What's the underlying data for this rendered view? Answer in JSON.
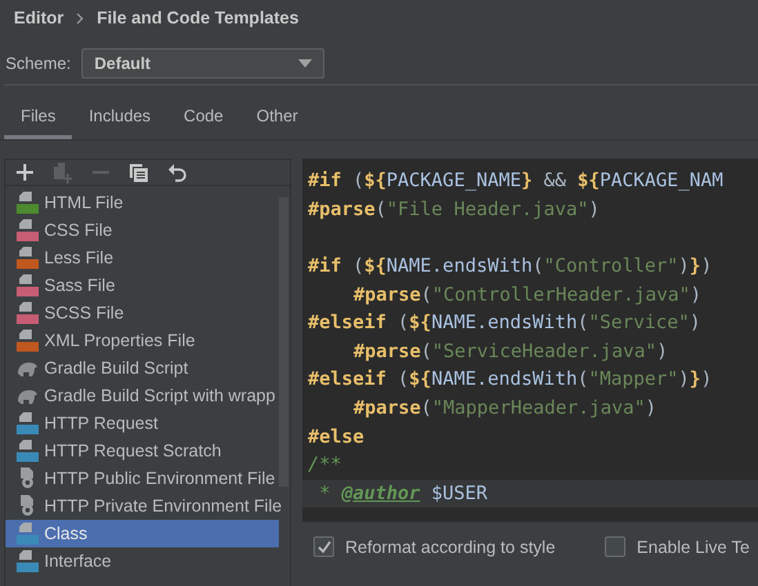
{
  "breadcrumb": [
    "Editor",
    "File and Code Templates"
  ],
  "scheme": {
    "label": "Scheme:",
    "value": "Default"
  },
  "tabs": [
    {
      "label": "Files",
      "selected": true
    },
    {
      "label": "Includes",
      "selected": false
    },
    {
      "label": "Code",
      "selected": false
    },
    {
      "label": "Other",
      "selected": false
    }
  ],
  "toolbar": [
    {
      "kind": "add",
      "disabled": false
    },
    {
      "kind": "add-file",
      "disabled": true
    },
    {
      "kind": "remove",
      "disabled": true
    },
    {
      "kind": "copy",
      "disabled": false
    },
    {
      "kind": "revert",
      "disabled": false
    }
  ],
  "templates": [
    {
      "label": "HTML File",
      "kind": "html",
      "selected": false
    },
    {
      "label": "CSS File",
      "kind": "css",
      "selected": false
    },
    {
      "label": "Less File",
      "kind": "less",
      "selected": false
    },
    {
      "label": "Sass File",
      "kind": "sass",
      "selected": false
    },
    {
      "label": "SCSS File",
      "kind": "sass",
      "selected": false
    },
    {
      "label": "XML Properties File",
      "kind": "xml",
      "selected": false
    },
    {
      "label": "Gradle Build Script",
      "kind": "gradle",
      "selected": false
    },
    {
      "label": "Gradle Build Script with wrapp",
      "kind": "gradle",
      "selected": false
    },
    {
      "label": "HTTP Request",
      "kind": "api",
      "selected": false
    },
    {
      "label": "HTTP Request Scratch",
      "kind": "api",
      "selected": false
    },
    {
      "label": "HTTP Public Environment File",
      "kind": "env",
      "selected": false
    },
    {
      "label": "HTTP Private Environment File",
      "kind": "env",
      "selected": false
    },
    {
      "label": "Class",
      "kind": "java",
      "selected": true
    },
    {
      "label": "Interface",
      "kind": "java",
      "selected": false
    }
  ],
  "code": [
    {
      "kind": "code",
      "indented": false,
      "current": false,
      "segments": [
        {
          "kind": "dir",
          "text": "#if"
        },
        {
          "kind": "punct",
          "text": " ("
        },
        {
          "kind": "brace",
          "text": "${"
        },
        {
          "kind": "var",
          "text": "PACKAGE_NAME"
        },
        {
          "kind": "brace",
          "text": "}"
        },
        {
          "kind": "punct",
          "text": " && "
        },
        {
          "kind": "brace",
          "text": "${"
        },
        {
          "kind": "var",
          "text": "PACKAGE_NAM"
        }
      ]
    },
    {
      "kind": "code",
      "indented": false,
      "current": false,
      "segments": [
        {
          "kind": "dir",
          "text": "#parse"
        },
        {
          "kind": "punct",
          "text": "("
        },
        {
          "kind": "str",
          "text": "\"File Header.java\""
        },
        {
          "kind": "punct",
          "text": ")"
        }
      ]
    },
    {
      "kind": "blank"
    },
    {
      "kind": "code",
      "indented": false,
      "current": false,
      "segments": [
        {
          "kind": "dir",
          "text": "#if"
        },
        {
          "kind": "punct",
          "text": " ("
        },
        {
          "kind": "brace",
          "text": "${"
        },
        {
          "kind": "var",
          "text": "NAME.endsWith"
        },
        {
          "kind": "punct",
          "text": "("
        },
        {
          "kind": "str",
          "text": "\"Controller\""
        },
        {
          "kind": "punct",
          "text": ")"
        },
        {
          "kind": "brace",
          "text": "}"
        },
        {
          "kind": "punct",
          "text": ")"
        }
      ]
    },
    {
      "kind": "code",
      "indented": true,
      "current": false,
      "segments": [
        {
          "kind": "dir",
          "text": "#parse"
        },
        {
          "kind": "punct",
          "text": "("
        },
        {
          "kind": "str",
          "text": "\"ControllerHeader.java\""
        },
        {
          "kind": "punct",
          "text": ")"
        }
      ]
    },
    {
      "kind": "code",
      "indented": false,
      "current": false,
      "segments": [
        {
          "kind": "dir",
          "text": "#elseif"
        },
        {
          "kind": "punct",
          "text": " ("
        },
        {
          "kind": "brace",
          "text": "${"
        },
        {
          "kind": "var",
          "text": "NAME.endsWith"
        },
        {
          "kind": "punct",
          "text": "("
        },
        {
          "kind": "str",
          "text": "\"Service\""
        },
        {
          "kind": "punct",
          "text": ")"
        }
      ]
    },
    {
      "kind": "code",
      "indented": true,
      "current": false,
      "segments": [
        {
          "kind": "dir",
          "text": "#parse"
        },
        {
          "kind": "punct",
          "text": "("
        },
        {
          "kind": "str",
          "text": "\"ServiceHeader.java\""
        },
        {
          "kind": "punct",
          "text": ")"
        }
      ]
    },
    {
      "kind": "code",
      "indented": false,
      "current": false,
      "segments": [
        {
          "kind": "dir",
          "text": "#elseif"
        },
        {
          "kind": "punct",
          "text": " ("
        },
        {
          "kind": "brace",
          "text": "${"
        },
        {
          "kind": "var",
          "text": "NAME.endsWith"
        },
        {
          "kind": "punct",
          "text": "("
        },
        {
          "kind": "str",
          "text": "\"Mapper\""
        },
        {
          "kind": "punct",
          "text": ")"
        },
        {
          "kind": "brace",
          "text": "}"
        },
        {
          "kind": "punct",
          "text": ")"
        }
      ]
    },
    {
      "kind": "code",
      "indented": true,
      "current": false,
      "segments": [
        {
          "kind": "dir",
          "text": "#parse"
        },
        {
          "kind": "punct",
          "text": "("
        },
        {
          "kind": "str",
          "text": "\"MapperHeader.java\""
        },
        {
          "kind": "punct",
          "text": ")"
        }
      ]
    },
    {
      "kind": "code",
      "indented": false,
      "current": false,
      "segments": [
        {
          "kind": "dir",
          "text": "#else"
        }
      ]
    },
    {
      "kind": "code",
      "indented": false,
      "current": false,
      "segments": [
        {
          "kind": "comment",
          "text": "/**"
        }
      ]
    },
    {
      "kind": "code",
      "indented": false,
      "current": true,
      "segments": [
        {
          "kind": "comment",
          "text": " * "
        },
        {
          "kind": "tag",
          "text": "@author"
        },
        {
          "kind": "var",
          "text": " $USER"
        }
      ]
    }
  ],
  "options": [
    {
      "label": "Reformat according to style",
      "checked": true
    },
    {
      "label": "Enable Live Te",
      "checked": false
    }
  ]
}
